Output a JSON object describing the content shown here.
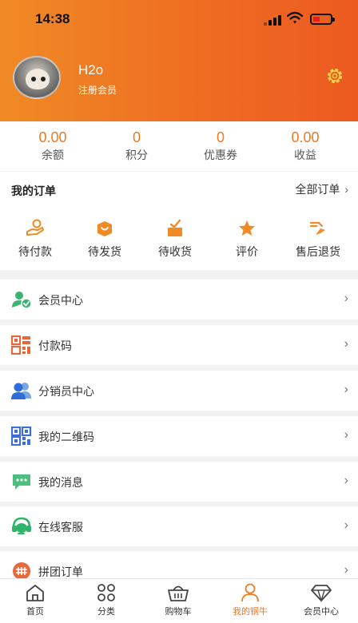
{
  "status_bar": {
    "time": "14:38"
  },
  "profile": {
    "name": "H2o",
    "level": "注册会员"
  },
  "stats": [
    {
      "value": "0.00",
      "label": "余额"
    },
    {
      "value": "0",
      "label": "积分"
    },
    {
      "value": "0",
      "label": "优惠券"
    },
    {
      "value": "0.00",
      "label": "收益"
    }
  ],
  "orders": {
    "title": "我的订单",
    "all_label": "全部订单",
    "items": [
      {
        "label": "待付款",
        "icon": "wallet-hand-icon"
      },
      {
        "label": "待发货",
        "icon": "package-icon"
      },
      {
        "label": "待收货",
        "icon": "box-check-icon"
      },
      {
        "label": "评价",
        "icon": "star-icon"
      },
      {
        "label": "售后退货",
        "icon": "return-icon"
      }
    ]
  },
  "menu": [
    {
      "label": "会员中心",
      "icon": "member-icon"
    },
    {
      "label": "付款码",
      "icon": "payment-code-icon"
    },
    {
      "label": "分销员中心",
      "icon": "distributor-icon"
    },
    {
      "label": "我的二维码",
      "icon": "qrcode-icon"
    },
    {
      "label": "我的消息",
      "icon": "message-icon"
    },
    {
      "label": "在线客服",
      "icon": "customer-service-icon"
    },
    {
      "label": "拼团订单",
      "icon": "group-order-icon"
    }
  ],
  "tabs": [
    {
      "label": "首页",
      "icon": "home-icon"
    },
    {
      "label": "分类",
      "icon": "category-icon"
    },
    {
      "label": "购物车",
      "icon": "cart-icon"
    },
    {
      "label": "我的钢牛",
      "icon": "user-icon",
      "active": true
    },
    {
      "label": "会员中心",
      "icon": "diamond-icon"
    }
  ],
  "colors": {
    "accent": "#ee7a24",
    "header_start": "#f08a24",
    "header_end": "#ec5a20"
  }
}
